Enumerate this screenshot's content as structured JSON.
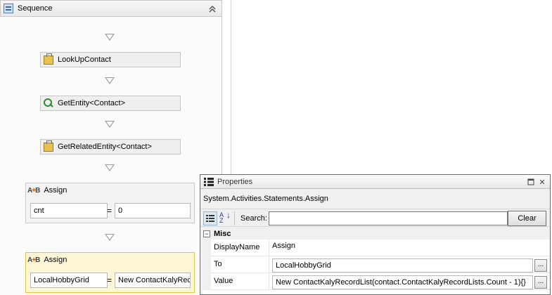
{
  "designer": {
    "sequence_title": "Sequence",
    "activities": [
      {
        "label": "LookUpContact"
      },
      {
        "label": "GetEntity<Contact>"
      },
      {
        "label": "GetRelatedEntity<Contact>"
      }
    ],
    "assign1": {
      "title": "Assign",
      "to": "cnt",
      "value": "0"
    },
    "assign2": {
      "title": "Assign",
      "to": "LocalHobbyGrid",
      "value": "New ContactKalyRec"
    }
  },
  "properties": {
    "title": "Properties",
    "object_type": "System.Activities.Statements.Assign",
    "search_label": "Search:",
    "search_value": "",
    "clear_label": "Clear",
    "category": "Misc",
    "rows": [
      {
        "name": "DisplayName",
        "value": "Assign"
      },
      {
        "name": "To",
        "value": "LocalHobbyGrid"
      },
      {
        "name": "Value",
        "value": "New ContactKalyRecordList(contact.ContactKalyRecordLists.Count - 1){}"
      }
    ],
    "ellipsis_label": "..."
  }
}
